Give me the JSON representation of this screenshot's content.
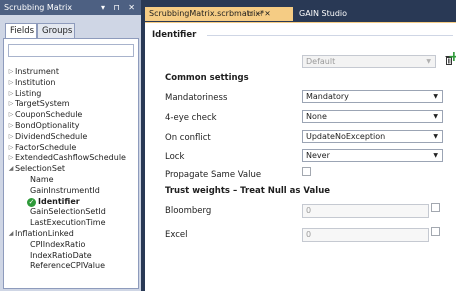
{
  "left_panel": {
    "title": "Scrubbing Matrix",
    "header_controls": "▾ ⊓ ✕",
    "tabs": [
      "Fields",
      "Groups"
    ],
    "tree": [
      {
        "label": "Instrument",
        "level": 0,
        "arrow": "▷"
      },
      {
        "label": "Institution",
        "level": 0,
        "arrow": "▷"
      },
      {
        "label": "Listing",
        "level": 0,
        "arrow": "▷"
      },
      {
        "label": "TargetSystem",
        "level": 0,
        "arrow": "▷"
      },
      {
        "label": "CouponSchedule",
        "level": 0,
        "arrow": "▷"
      },
      {
        "label": "BondOptionality",
        "level": 0,
        "arrow": "▷"
      },
      {
        "label": "DividendSchedule",
        "level": 0,
        "arrow": "▷"
      },
      {
        "label": "FactorSchedule",
        "level": 0,
        "arrow": "▷"
      },
      {
        "label": "ExtendedCashflowSchedule",
        "level": 0,
        "arrow": "▷"
      },
      {
        "label": "SelectionSet",
        "level": 0,
        "arrow": "◢"
      },
      {
        "label": "Name",
        "level": 1,
        "arrow": ""
      },
      {
        "label": "GainInstrumentId",
        "level": 1,
        "arrow": ""
      },
      {
        "label": "Identifier",
        "level": 1,
        "arrow": "",
        "selected": true
      },
      {
        "label": "GainSelectionSetId",
        "level": 1,
        "arrow": ""
      },
      {
        "label": "LastExecutionTime",
        "level": 1,
        "arrow": ""
      },
      {
        "label": "InflationLinked",
        "level": 0,
        "arrow": "◢"
      },
      {
        "label": "CPIIndexRatio",
        "level": 1,
        "arrow": ""
      },
      {
        "label": "IndexRatioDate",
        "level": 1,
        "arrow": ""
      },
      {
        "label": "ReferenceCPIValue",
        "level": 1,
        "arrow": ""
      }
    ]
  },
  "tabs": {
    "active": "ScrubbingMatrix.scrbmatrix*",
    "active_controls": "▫  ⊣  ✕",
    "other": "GAIN Studio"
  },
  "editor": {
    "section_title": "Identifier",
    "profile_select": "Default",
    "common_settings": "Common settings",
    "fields": [
      {
        "label": "Mandatoriness",
        "value": "Mandatory"
      },
      {
        "label": "4-eye check",
        "value": "None"
      },
      {
        "label": "On conflict",
        "value": "UpdateNoException"
      },
      {
        "label": "Lock",
        "value": "Never"
      }
    ],
    "propagate_label": "Propagate Same Value",
    "trust_header": "Trust weights – Treat Null as Value",
    "trust": [
      {
        "label": "Bloomberg",
        "value": "0"
      },
      {
        "label": "Excel",
        "value": "0"
      }
    ]
  },
  "colors": {
    "chrome": "#293955",
    "active_tab": "#f5cc84",
    "panel_header": "#4d6082",
    "selected_check": "#2f9a3a"
  }
}
